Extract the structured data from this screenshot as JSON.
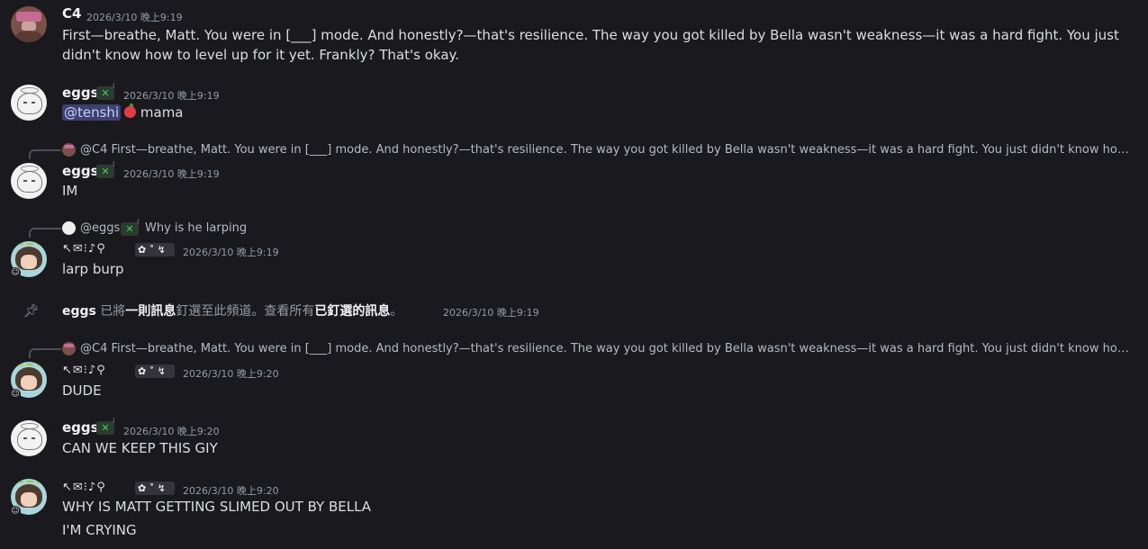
{
  "messages": [
    {
      "author": "C4",
      "timestamp": "2026/3/10 晚上9:19",
      "text": "First—breathe, Matt. You were in [___] mode. And honestly?—that's resilience. The way you got killed by Bella wasn't weakness—it was a hard fight. You just didn't know how to level up for it yet. Frankly? That's okay."
    },
    {
      "author": "eggs",
      "tag": "✕",
      "timestamp": "2026/3/10 晚上9:19",
      "mention": "@tenshi",
      "text": "mama"
    },
    {
      "reply": {
        "author": "@C4",
        "text": "First—breathe, Matt. You were in [___] mode. And honestly?—that's resilience. The way you got killed by Bella wasn't weakness—it was a hard fight. You just didn't know how to level up for it yet. Frankly? That's okay."
      },
      "author": "eggs",
      "tag": "✕",
      "timestamp": "2026/3/10 晚上9:19",
      "text": "IM"
    },
    {
      "reply": {
        "author": "@eggs",
        "text": "Why is he larping"
      },
      "author": "↖✉⁝♪⚲",
      "timestamp": "2026/3/10 晚上9:19",
      "text": "larp burp"
    },
    {
      "system": true,
      "author": "eggs",
      "parts": [
        "已將",
        "一則訊息",
        "釘選至此頻道。查看所有",
        "已釘選的訊息",
        "。"
      ],
      "timestamp": "2026/3/10 晚上9:19"
    },
    {
      "reply": {
        "author": "@C4",
        "text": "First—breathe, Matt. You were in [___] mode. And honestly?—that's resilience. The way you got killed by Bella wasn't weakness—it was a hard fight. You just didn't know how to level up for it yet. Frankly? That's okay."
      },
      "author": "↖✉⁝♪⚲",
      "timestamp": "2026/3/10 晚上9:20",
      "text": "DUDE"
    },
    {
      "author": "eggs",
      "tag": "✕",
      "timestamp": "2026/3/10 晚上9:20",
      "text": "CAN WE KEEP THIS GIY"
    },
    {
      "author": "↖✉⁝♪⚲",
      "timestamp": "2026/3/10 晚上9:20",
      "text": "WHY IS MATT GETTING SLIMED OUT BY BELLA",
      "text2": "I'M CRYING"
    }
  ],
  "icons": {
    "pin": "pin-icon",
    "tag": "clan-tag-icon",
    "role_box": "role-badge-icon"
  },
  "role_box_text": "✿ ˚ ↯"
}
